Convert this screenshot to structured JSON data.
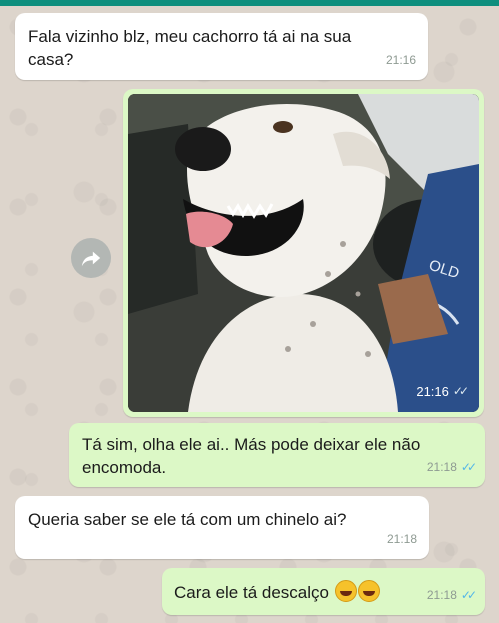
{
  "messages": {
    "m1": {
      "text": "Fala vizinho blz, meu cachorro tá ai na sua casa?",
      "time": "21:16"
    },
    "photo": {
      "time": "21:16",
      "shirt_text": "OLD"
    },
    "m2": {
      "text": "Tá sim, olha ele ai.. Más pode deixar ele não encomoda.",
      "time": "21:18"
    },
    "m3": {
      "text": "Queria saber se ele tá com um chinelo ai?",
      "time": "21:18"
    },
    "m4": {
      "text": "Cara ele tá descalço",
      "time": "21:18"
    }
  },
  "icons": {
    "forward": "forward-arrow-icon",
    "read_receipt": "double-check-icon",
    "emoji": "laughing-tears-emoji-icon"
  },
  "colors": {
    "incoming_bubble": "#ffffff",
    "outgoing_bubble": "#dcf8c6",
    "chat_background": "#ddd5cc",
    "read_ticks": "#53b6e8"
  }
}
